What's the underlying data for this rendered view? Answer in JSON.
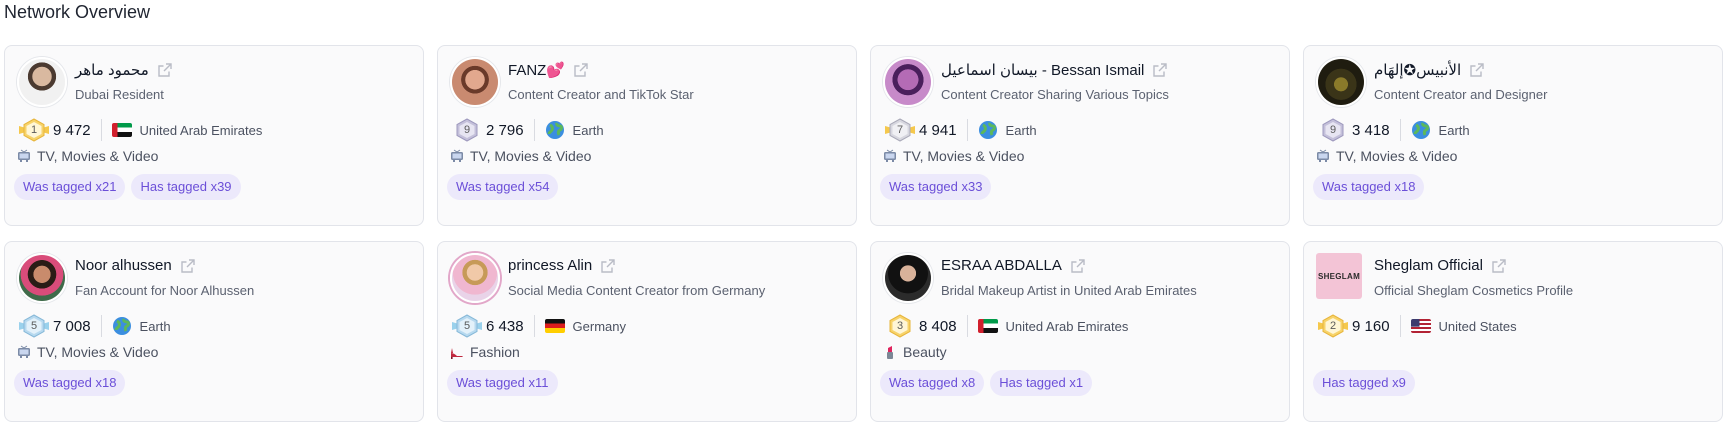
{
  "page": {
    "title": "Network Overview"
  },
  "cards": [
    {
      "name": "محمود ماهر",
      "subtitle": "Dubai Resident",
      "rank": "1",
      "score": "9 472",
      "location": "United Arab Emirates",
      "location_icon": "uae-flag",
      "category": "TV, Movies & Video",
      "category_icon": "tv-icon",
      "tags": [
        "Was tagged x21",
        "Has tagged x39"
      ]
    },
    {
      "name": "FANZ💕",
      "subtitle": "Content Creator and TikTok Star",
      "rank": "9",
      "score": "2 796",
      "location": "Earth",
      "location_icon": "globe-icon",
      "category": "TV, Movies & Video",
      "category_icon": "tv-icon",
      "tags": [
        "Was tagged x54"
      ]
    },
    {
      "name": "بيسان اسماعيل - Bessan Ismail",
      "subtitle": "Content Creator Sharing Various Topics",
      "rank": "7",
      "score": "4 941",
      "location": "Earth",
      "location_icon": "globe-icon",
      "category": "TV, Movies & Video",
      "category_icon": "tv-icon",
      "tags": [
        "Was tagged x33"
      ]
    },
    {
      "name": "الأنبيس✪إلهَام",
      "subtitle": "Content Creator and Designer",
      "rank": "9",
      "score": "3 418",
      "location": "Earth",
      "location_icon": "globe-icon",
      "category": "TV, Movies & Video",
      "category_icon": "tv-icon",
      "tags": [
        "Was tagged x18"
      ]
    },
    {
      "name": "Noor alhussen",
      "subtitle": "Fan Account for Noor Alhussen",
      "rank": "5",
      "score": "7 008",
      "location": "Earth",
      "location_icon": "globe-icon",
      "category": "TV, Movies & Video",
      "category_icon": "tv-icon",
      "tags": [
        "Was tagged x18"
      ]
    },
    {
      "name": "princess Alin",
      "subtitle": "Social Media Content Creator from Germany",
      "rank": "5",
      "score": "6 438",
      "location": "Germany",
      "location_icon": "germany-flag",
      "category": "Fashion",
      "category_icon": "high-heel-icon",
      "tags": [
        "Was tagged x11"
      ]
    },
    {
      "name": "ESRAA ABDALLA",
      "subtitle": "Bridal Makeup Artist in United Arab Emirates",
      "rank": "3",
      "score": "8 408",
      "location": "United Arab Emirates",
      "location_icon": "uae-flag",
      "category": "Beauty",
      "category_icon": "lipstick-icon",
      "tags": [
        "Was tagged x8",
        "Has tagged x1"
      ]
    },
    {
      "name": "Sheglam Official",
      "subtitle": "Official Sheglam Cosmetics Profile",
      "rank": "2",
      "score": "9 160",
      "location": "United States",
      "location_icon": "usa-flag",
      "category": "",
      "category_icon": "",
      "tags": [
        "Has tagged x9"
      ],
      "logo_text": "SHEGLAM"
    }
  ],
  "colors": {
    "tag_bg": "#ece9fb",
    "tag_text": "#6b4fd8",
    "rank_gold": "#f5c84c",
    "rank_silver": "#b8b4cf",
    "rank_blue": "#9ad1ec"
  }
}
